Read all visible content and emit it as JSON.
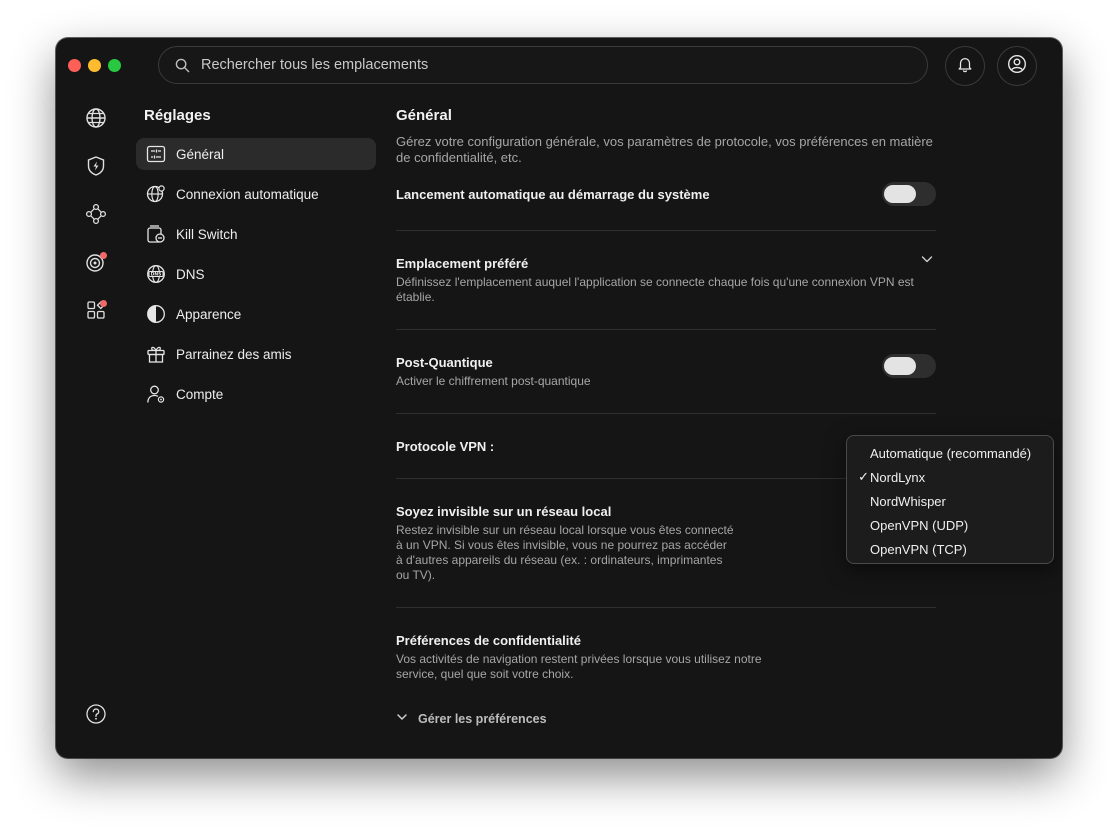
{
  "search": {
    "placeholder": "Rechercher tous les emplacements"
  },
  "sidebar": {
    "title": "Réglages",
    "items": [
      {
        "label": "Général",
        "icon": "sliders-icon",
        "active": true
      },
      {
        "label": "Connexion automatique",
        "icon": "globe-gear-icon"
      },
      {
        "label": "Kill Switch",
        "icon": "kill-switch-icon"
      },
      {
        "label": "DNS",
        "icon": "dns-globe-icon"
      },
      {
        "label": "Apparence",
        "icon": "half-circle-icon"
      },
      {
        "label": "Parrainez des amis",
        "icon": "gift-icon"
      },
      {
        "label": "Compte",
        "icon": "account-gear-icon"
      }
    ]
  },
  "rail": [
    "globe-icon",
    "shield-bolt-icon",
    "meshnet-icon",
    "threat-radar-icon",
    "apps-grid-icon",
    "help-icon"
  ],
  "main": {
    "title": "Général",
    "description": "Gérez votre configuration générale, vos paramètres de protocole, vos préférences en matière de confidentialité, etc.",
    "autolaunch": {
      "title": "Lancement automatique au démarrage du système",
      "enabled": false
    },
    "preferred_location": {
      "title": "Emplacement préféré",
      "description": "Définissez l'emplacement auquel l'application se connecte chaque fois qu'une connexion VPN est établie."
    },
    "post_quantum": {
      "title": "Post-Quantique",
      "description": "Activer le chiffrement post-quantique",
      "enabled": false
    },
    "protocol": {
      "title": "Protocole VPN :"
    },
    "invisible": {
      "title": "Soyez invisible sur un réseau local",
      "description": "Restez invisible sur un réseau local lorsque vous êtes connecté à un VPN. Si vous êtes invisible, vous ne pourrez pas accéder à d'autres appareils du réseau (ex. : ordinateurs, imprimantes ou TV)."
    },
    "privacy": {
      "title": "Préférences de confidentialité",
      "description": "Vos activités de navigation restent privées lorsque vous utilisez notre service, quel que soit votre choix.",
      "manage_label": "Gérer les préférences"
    }
  },
  "protocol_dropdown": {
    "options": [
      {
        "label": "Automatique (recommandé)",
        "checked": false
      },
      {
        "label": "NordLynx",
        "checked": true
      },
      {
        "label": "NordWhisper",
        "checked": false
      },
      {
        "label": "OpenVPN (UDP)",
        "checked": false
      },
      {
        "label": "OpenVPN (TCP)",
        "checked": false
      }
    ],
    "check_glyph": "✓"
  },
  "colors": {
    "background": "#151515",
    "badge": "#ef6a6a",
    "accent_text": "#f0f0f0"
  }
}
